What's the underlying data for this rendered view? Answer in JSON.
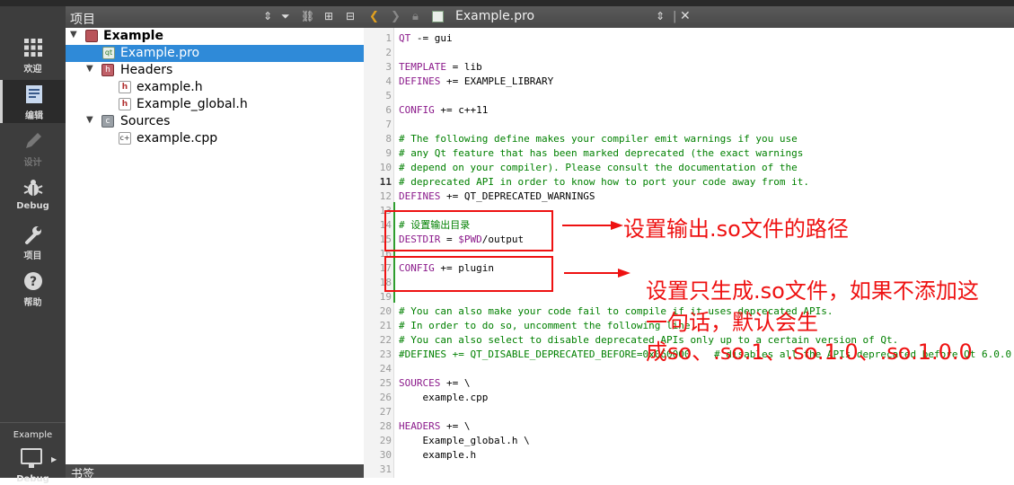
{
  "left_modes": [
    {
      "label": "欢迎",
      "icon": "grid-icon"
    },
    {
      "label": "编辑",
      "icon": "document-icon"
    },
    {
      "label": "设计",
      "icon": "pencil-icon"
    },
    {
      "label": "Debug",
      "icon": "bug-icon"
    },
    {
      "label": "项目",
      "icon": "wrench-icon"
    },
    {
      "label": "帮助",
      "icon": "help-icon"
    }
  ],
  "kit": {
    "name": "Example",
    "build": "Debug"
  },
  "project_panel": {
    "title": "项目",
    "tree": [
      {
        "label": "Example",
        "type": "project"
      },
      {
        "label": "Example.pro",
        "type": "pro"
      },
      {
        "label": "Headers",
        "type": "folder"
      },
      {
        "label": "example.h",
        "type": "h"
      },
      {
        "label": "Example_global.h",
        "type": "h"
      },
      {
        "label": "Sources",
        "type": "folder"
      },
      {
        "label": "example.cpp",
        "type": "cpp"
      }
    ],
    "bottom_title": "书签"
  },
  "editor": {
    "filename": "Example.pro",
    "current_line": 11,
    "lines": [
      {
        "n": 1,
        "text": "QT -= gui"
      },
      {
        "n": 2,
        "text": ""
      },
      {
        "n": 3,
        "text": "TEMPLATE = lib"
      },
      {
        "n": 4,
        "text": "DEFINES += EXAMPLE_LIBRARY"
      },
      {
        "n": 5,
        "text": ""
      },
      {
        "n": 6,
        "text": "CONFIG += c++11"
      },
      {
        "n": 7,
        "text": ""
      },
      {
        "n": 8,
        "text": "# The following define makes your compiler emit warnings if you use"
      },
      {
        "n": 9,
        "text": "# any Qt feature that has been marked deprecated (the exact warnings"
      },
      {
        "n": 10,
        "text": "# depend on your compiler). Please consult the documentation of the"
      },
      {
        "n": 11,
        "text": "# deprecated API in order to know how to port your code away from it."
      },
      {
        "n": 12,
        "text": "DEFINES += QT_DEPRECATED_WARNINGS"
      },
      {
        "n": 13,
        "text": ""
      },
      {
        "n": 14,
        "text": "# 设置输出目录"
      },
      {
        "n": 15,
        "text": "DESTDIR = $$PWD/output"
      },
      {
        "n": 16,
        "text": ""
      },
      {
        "n": 17,
        "text": "CONFIG += plugin"
      },
      {
        "n": 18,
        "text": ""
      },
      {
        "n": 19,
        "text": ""
      },
      {
        "n": 20,
        "text": "# You can also make your code fail to compile if it uses deprecated APIs."
      },
      {
        "n": 21,
        "text": "# In order to do so, uncomment the following line."
      },
      {
        "n": 22,
        "text": "# You can also select to disable deprecated APIs only up to a certain version of Qt."
      },
      {
        "n": 23,
        "text": "#DEFINES += QT_DISABLE_DEPRECATED_BEFORE=0x060000    # disables all the APIs deprecated before Qt 6.0.0"
      },
      {
        "n": 24,
        "text": ""
      },
      {
        "n": 25,
        "text": "SOURCES += \\"
      },
      {
        "n": 26,
        "text": "    example.cpp"
      },
      {
        "n": 27,
        "text": ""
      },
      {
        "n": 28,
        "text": "HEADERS += \\"
      },
      {
        "n": 29,
        "text": "    Example_global.h \\"
      },
      {
        "n": 30,
        "text": "    example.h"
      },
      {
        "n": 31,
        "text": ""
      }
    ]
  },
  "annotations": {
    "note1": "设置输出.so文件的路径",
    "note2_line1": "设置只生成.so文件，如果不添加这",
    "note2_line2": "一句话，默认会生",
    "note2_line3": "成so、.so.1、.so.1.0、.so.1.0.0",
    "color": "#ee1111"
  }
}
